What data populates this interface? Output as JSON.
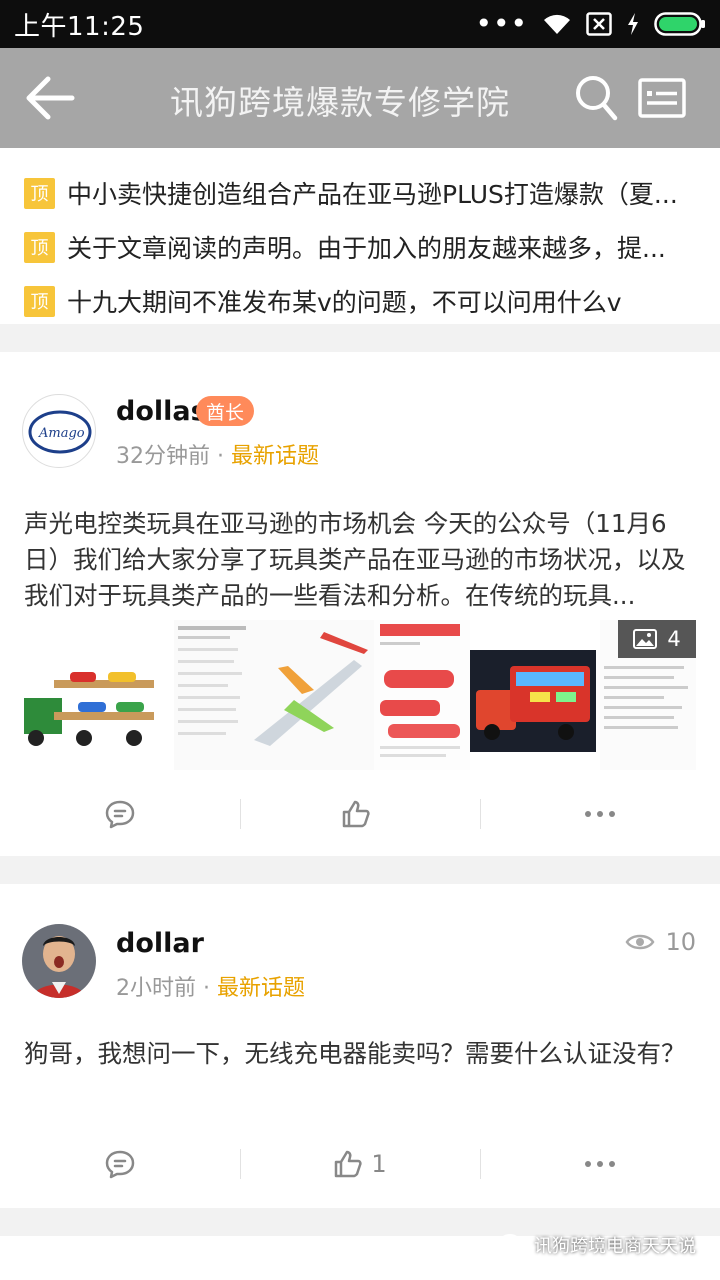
{
  "status_bar": {
    "time": "上午11:25",
    "more": "•••"
  },
  "header": {
    "title": "讯狗跨境爆款专修学院"
  },
  "pinned": {
    "badge": "顶",
    "items": [
      "中小卖快捷创造组合产品在亚马逊PLUS打造爆款（夏...",
      "关于文章阅读的声明。由于加入的朋友越来越多，提...",
      "十九大期间不准发布某v的问题，不可以问用什么v"
    ]
  },
  "posts": [
    {
      "username": "dollas",
      "role": "酋长",
      "avatar_text": "Amago",
      "time": "32分钟前",
      "separator": "·",
      "topic": "最新话题",
      "body": "声光电控类玩具在亚马逊的市场机会 今天的公众号（11月6日）我们给大家分享了玩具类产品在亚马逊的市场状况，以及我们对于玩具类产品的一些看法和分析。在传统的玩具...",
      "image_count": "4",
      "likes": ""
    },
    {
      "username": "dollar",
      "time": "2小时前",
      "separator": "·",
      "topic": "最新话题",
      "views": "10",
      "body": "狗哥，我想问一下，无线充电器能卖吗？需要什么认证没有？",
      "likes": "1"
    }
  ],
  "watermark": "讯狗跨境电商天天说",
  "colors": {
    "header_bg": "#a6a6a6",
    "pin_badge": "#f7c53a",
    "topic": "#e8a200",
    "role_badge": "#ff8a5a"
  }
}
